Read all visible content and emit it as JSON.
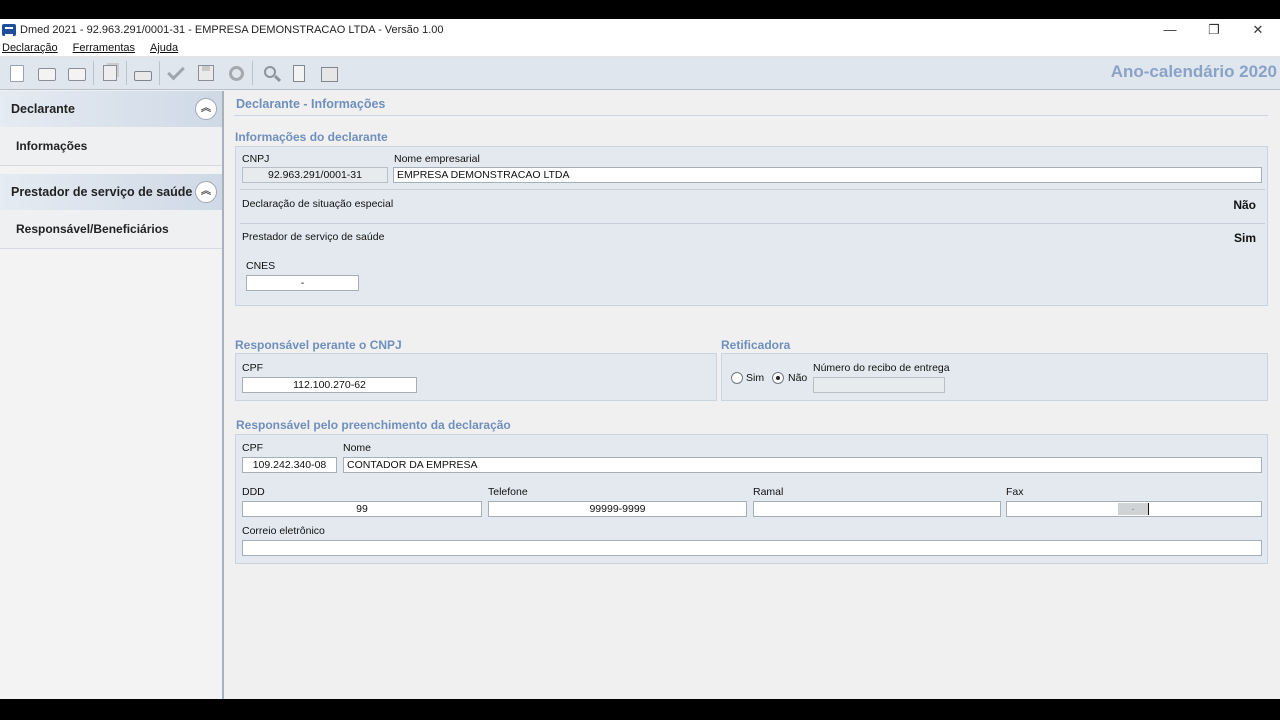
{
  "window": {
    "title": "Dmed 2021 - 92.963.291/0001-31 - EMPRESA DEMONSTRACAO LTDA - Versão 1.00",
    "controls": [
      "—",
      "❐",
      "✕"
    ]
  },
  "menu": [
    "Declaração",
    "Ferramentas",
    "Ajuda"
  ],
  "toolbar": {
    "icons": [
      "new-icon",
      "open-folder-icon",
      "folder-icon",
      "copy-icon",
      "print-icon",
      "check-icon",
      "save-icon",
      "settings-icon",
      "search-icon",
      "calculator-icon",
      "package-icon"
    ],
    "year_label": "Ano-calendário 2020"
  },
  "sidebar": {
    "sections": [
      {
        "title": "Declarante",
        "items": [
          "Informações"
        ]
      },
      {
        "title": "Prestador de serviço de saúde",
        "items": [
          "Responsável/Beneficiários"
        ]
      }
    ]
  },
  "main": {
    "page_title": "Declarante - Informações",
    "declarante": {
      "section_title": "Informações do declarante",
      "cnpj_label": "CNPJ",
      "cnpj_value": "92.963.291/0001-31",
      "nome_label": "Nome empresarial",
      "nome_value": "EMPRESA DEMONSTRACAO LTDA",
      "situacao_label": "Declaração de situação especial",
      "situacao_value": "Não",
      "prestador_label": "Prestador de serviço de saúde",
      "prestador_value": "Sim",
      "cnes_label": "CNES",
      "cnes_value": "-"
    },
    "responsavel_cnpj": {
      "section_title": "Responsável perante o CNPJ",
      "cpf_label": "CPF",
      "cpf_value": "112.100.270-62"
    },
    "retificadora": {
      "section_title": "Retificadora",
      "sim_label": "Sim",
      "nao_label": "Não",
      "selected": "Não",
      "recibo_label": "Número do recibo de entrega",
      "recibo_value": ""
    },
    "preenchimento": {
      "section_title": "Responsável pelo preenchimento da declaração",
      "cpf_label": "CPF",
      "cpf_value": "109.242.340-08",
      "nome_label": "Nome",
      "nome_value": "CONTADOR DA EMPRESA",
      "ddd_label": "DDD",
      "ddd_value": "99",
      "telefone_label": "Telefone",
      "telefone_value": "99999-9999",
      "ramal_label": "Ramal",
      "ramal_value": "",
      "fax_label": "Fax",
      "fax_value": "-",
      "email_label": "Correio eletrônico",
      "email_value": ""
    }
  }
}
